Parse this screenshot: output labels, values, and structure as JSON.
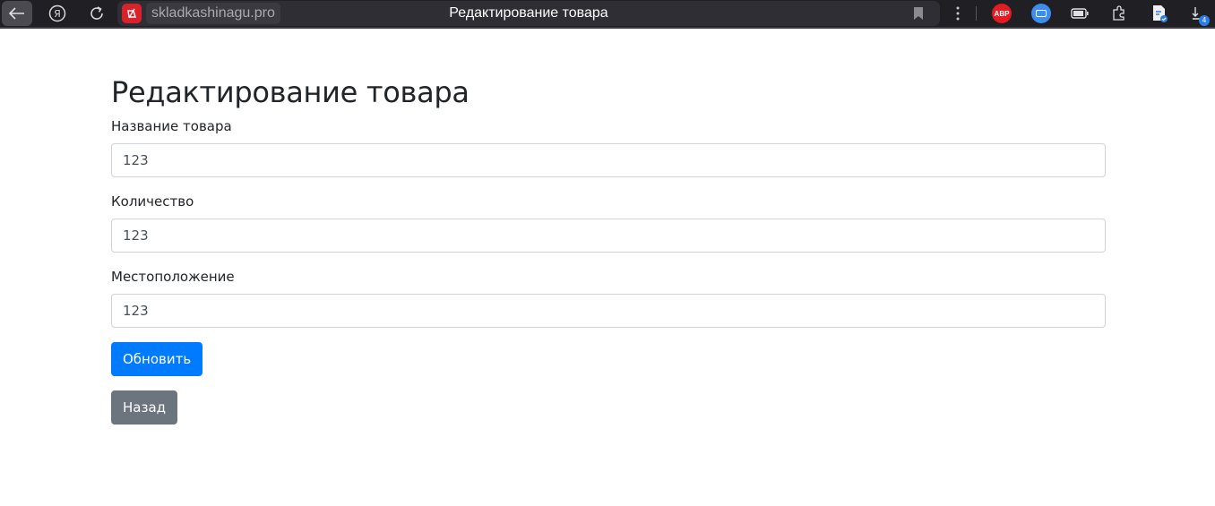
{
  "browser": {
    "domain": "skladkashinagu.pro",
    "tab_title": "Редактирование товара",
    "extensions": {
      "abp_label": "ABP",
      "downloads_count": "4"
    },
    "icons": [
      "back-arrow-icon",
      "yandex-icon",
      "reload-icon",
      "site-icon",
      "bookmark-icon",
      "more-icon",
      "abp-icon",
      "extension-icon",
      "battery-icon",
      "puzzle-icon",
      "document-icon",
      "download-icon"
    ]
  },
  "page": {
    "title": "Редактирование товара",
    "fields": [
      {
        "label": "Название товара",
        "value": "123"
      },
      {
        "label": "Количество",
        "value": "123"
      },
      {
        "label": "Местоположение",
        "value": "123"
      }
    ],
    "update_button": "Обновить",
    "back_button": "Назад"
  },
  "colors": {
    "primary": "#007bff",
    "secondary": "#6c757d",
    "chrome": "#1f1f24"
  }
}
